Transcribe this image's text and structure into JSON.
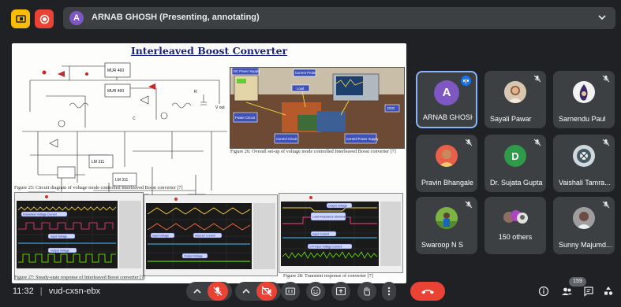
{
  "presentation_bar": {
    "presenter_initial": "A",
    "presenter_text": "ARNAB GHOSH (Presenting, annotating)"
  },
  "slide": {
    "title": "Interleaved Boost Converter",
    "fig25": "Figure 25: Circuit diagram of voltage mode controlled Interleaved Boost converter [7]",
    "fig26": "Figure 26: Overall set-up of voltage mode controlled Interleaved Boost converter [7]",
    "fig27": "Figure 27: Steady-state response of Interleaved Boost converter [7]",
    "fig28": "Figure 28: Transient response of converter [7]",
    "photo_labels": [
      "DC Power Supply",
      "Current Probe",
      "Load",
      "Power Circuit",
      "Control Circuit",
      "Control Power Supply",
      "DSO"
    ],
    "scope_labels": {
      "s1": [
        "Freewheel Voltage Current",
        "Input Voltage",
        "Output Voltage"
      ],
      "s2": [
        "Input Voltage",
        "Inductor Current",
        "Output Voltage"
      ],
      "s3": [
        "Output Voltage",
        "Load Resistance Disturbance",
        "Input Current",
        "17V Input Voltage Current"
      ]
    }
  },
  "participants": [
    {
      "name": "ARNAB GHOSH",
      "initial": "A",
      "color": "#7e57c2",
      "avatar": "letter",
      "speaking": true
    },
    {
      "name": "Sayali Pawar",
      "avatar": "photo",
      "muted": true
    },
    {
      "name": "Sarnendu Paul",
      "avatar": "photo",
      "muted": true
    },
    {
      "name": "Pravin Bhangale",
      "avatar": "photo",
      "muted": true
    },
    {
      "name": "Dr. Sujata Gupta",
      "initial": "D",
      "color": "#2e9a4a",
      "avatar": "letter",
      "muted": true
    },
    {
      "name": "Vaishali Tamra...",
      "avatar": "photo",
      "muted": true
    },
    {
      "name": "Swaroop N S",
      "avatar": "photo",
      "muted": true
    },
    {
      "name": "150 others",
      "avatar": "group"
    },
    {
      "name": "Sunny Majumd...",
      "avatar": "photo",
      "muted": true
    }
  ],
  "bottom_bar": {
    "time": "11:32",
    "meeting_code": "vud-cxsn-ebx",
    "participant_count": "159",
    "icons": [
      "expand-up-icon",
      "mic-off-icon",
      "expand-up-icon",
      "camera-off-icon",
      "captions-icon",
      "emoji-icon",
      "present-icon",
      "raise-hand-icon",
      "more-options-icon",
      "leave-call-icon",
      "info-icon",
      "people-icon",
      "chat-icon",
      "activities-icon"
    ]
  },
  "colors": {
    "background": "#202124",
    "tile": "#3c4043",
    "accent_blue": "#8ab4f8",
    "danger_red": "#ea4335",
    "present_yellow": "#fbbc04"
  }
}
